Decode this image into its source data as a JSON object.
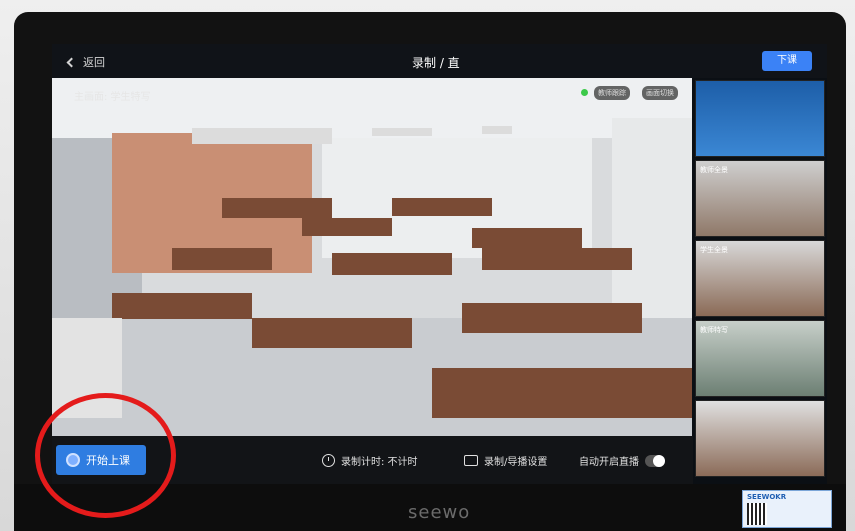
{
  "topbar": {
    "back_label": "返回",
    "title": "录制 / 直",
    "action_label": "下课"
  },
  "main_view": {
    "label": "主画面: 学生特写",
    "tags": [
      "教师跟踪",
      "画面切换"
    ]
  },
  "thumbnails": [
    {
      "label": ""
    },
    {
      "label": "教师全景"
    },
    {
      "label": "学生全景"
    },
    {
      "label": "教师特写"
    },
    {
      "label": ""
    }
  ],
  "bottom_bar": {
    "start_label": "开始上课",
    "timer_label": "录制计时: 不计时",
    "settings_label": "录制/导播设置",
    "auto_live_label": "自动开启直播"
  },
  "device": {
    "brand": "seewo"
  },
  "sticker": {
    "title": "SEEWOKR"
  },
  "colors": {
    "accent_blue": "#2f7de1",
    "annotation_red": "#e41b1b",
    "screen_bg": "#0b0f14"
  }
}
